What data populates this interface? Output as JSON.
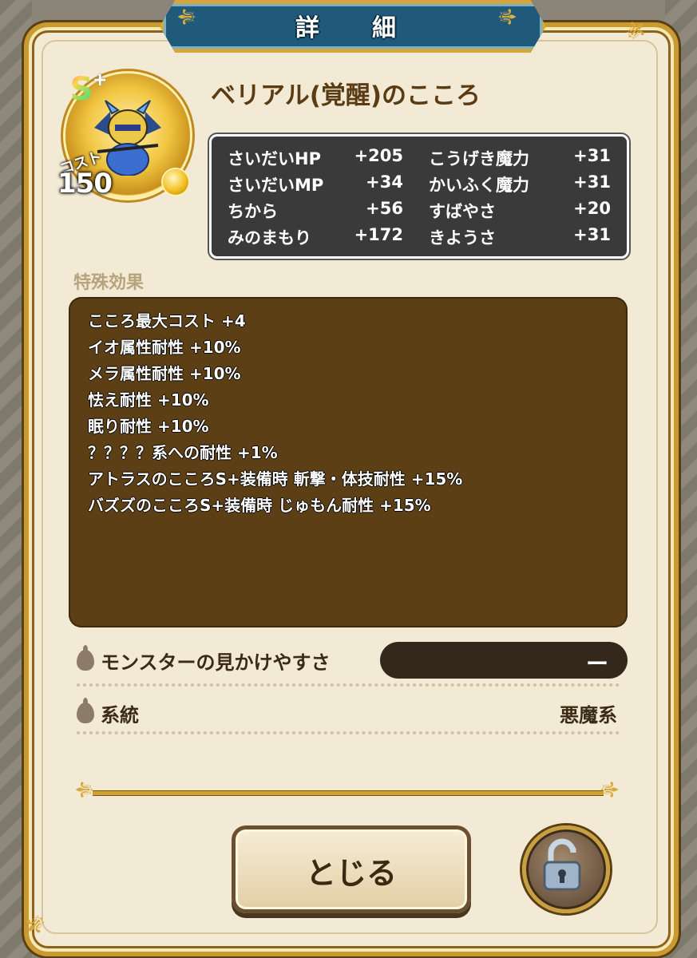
{
  "header": {
    "title": "詳　細"
  },
  "monster": {
    "rank": "S",
    "rank_plus": "+",
    "cost_label": "コスト",
    "cost": "150",
    "name": "ベリアル(覚醒)のこころ"
  },
  "stats": [
    {
      "label": "さいだいHP",
      "value": "+205"
    },
    {
      "label": "さいだいMP",
      "value": "+34"
    },
    {
      "label": "ちから",
      "value": "+56"
    },
    {
      "label": "みのまもり",
      "value": "+172"
    },
    {
      "label": "こうげき魔力",
      "value": "+31"
    },
    {
      "label": "かいふく魔力",
      "value": "+31"
    },
    {
      "label": "すばやさ",
      "value": "+20"
    },
    {
      "label": "きようさ",
      "value": "+31"
    }
  ],
  "special_effects": {
    "label": "特殊効果",
    "items": [
      "こころ最大コスト +4",
      "イオ属性耐性 +10%",
      "メラ属性耐性 +10%",
      "怯え耐性 +10%",
      "眠り耐性 +10%",
      "？？？？系への耐性 +1%",
      "アトラスのこころS+装備時 斬撃・体技耐性 +15%",
      "バズズのこころS+装備時 じゅもん耐性 +15%"
    ]
  },
  "info": {
    "visibility_label": "モンスターの見かけやすさ",
    "visibility_value": "ー",
    "family_label": "系統",
    "family_value": "悪魔系"
  },
  "buttons": {
    "close_label": "とじる"
  },
  "icons": {
    "lock": "unlocked-padlock-icon",
    "bullet": "onion-bullet-icon",
    "orb": "gold-orb-icon"
  },
  "colors": {
    "panel_bg": "#f3ead5",
    "frame_gold": "#c89a32",
    "banner_blue": "#1f5a7a",
    "effects_bg": "#5c3f14",
    "stats_bg": "#3a3a3a"
  }
}
